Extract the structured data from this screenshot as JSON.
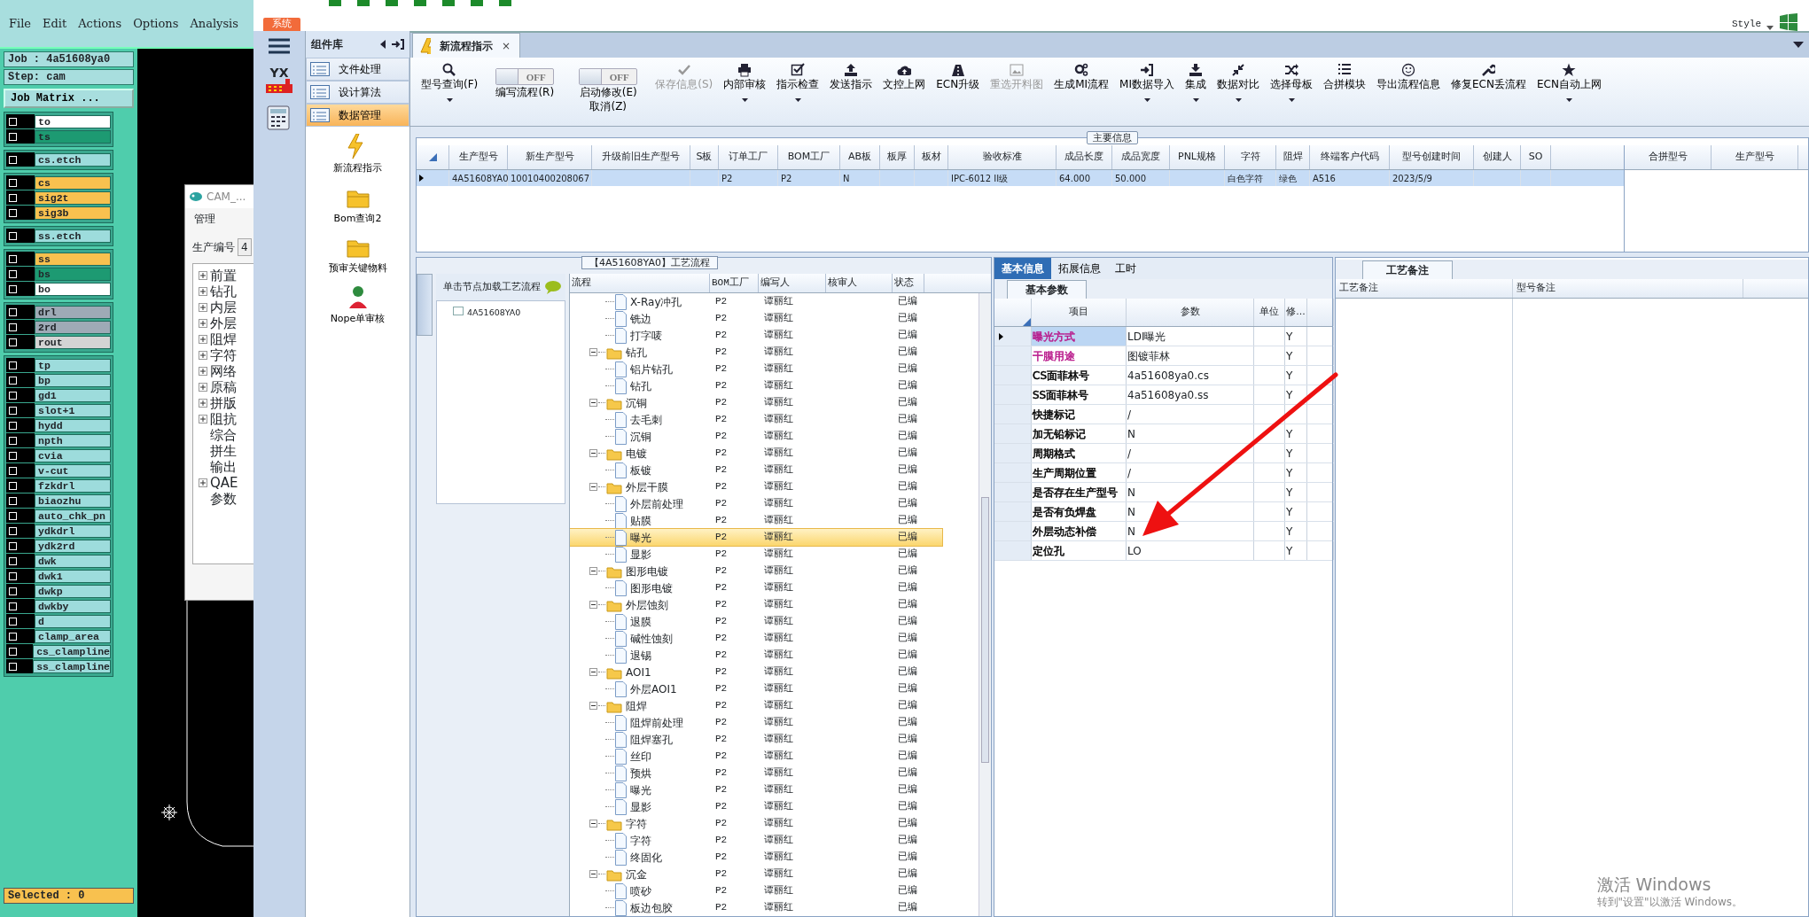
{
  "cam": {
    "menu": [
      "File",
      "Edit",
      "Actions",
      "Options",
      "Analysis"
    ],
    "job": "Job : 4a51608ya0",
    "step": "Step: cam",
    "matrix_button": "Job Matrix ...",
    "layer_groups": [
      {
        "layers": [
          {
            "name": "to",
            "color": "#ffffff",
            "checked": false
          },
          {
            "name": "ts",
            "color": "#1d9a72",
            "checked": false
          }
        ]
      },
      {
        "layers": [
          {
            "name": "cs.etch",
            "color": "#9ddcdc",
            "checked": false
          }
        ]
      },
      {
        "layers": [
          {
            "name": "cs",
            "color": "#f8c14f",
            "checked": false
          },
          {
            "name": "sig2t",
            "color": "#f8c14f",
            "checked": false
          },
          {
            "name": "sig3b",
            "color": "#f8c14f",
            "checked": false
          }
        ]
      },
      {
        "layers": [
          {
            "name": "ss.etch",
            "color": "#9ddcdc",
            "checked": false
          }
        ]
      },
      {
        "layers": [
          {
            "name": "ss",
            "color": "#f8c14f",
            "checked": false
          },
          {
            "name": "bs",
            "color": "#1d9a72",
            "checked": false
          },
          {
            "name": "bo",
            "color": "#ffffff",
            "checked": false
          }
        ]
      },
      {
        "layers": [
          {
            "name": "drl",
            "color": "#9eaab6",
            "checked": false
          },
          {
            "name": "2rd",
            "color": "#9eaab6",
            "checked": false
          },
          {
            "name": "rout",
            "color": "#d4d4d4",
            "checked": false
          }
        ]
      },
      {
        "layers": [
          {
            "name": "tp",
            "color": "#9ddcdc",
            "checked": false
          },
          {
            "name": "bp",
            "color": "#9ddcdc",
            "checked": false
          },
          {
            "name": "gd1",
            "color": "#9ddcdc",
            "checked": false
          },
          {
            "name": "slot+1",
            "color": "#9ddcdc",
            "checked": false
          },
          {
            "name": "hydd",
            "color": "#9ddcdc",
            "checked": false
          },
          {
            "name": "npth",
            "color": "#9ddcdc",
            "checked": false
          },
          {
            "name": "cvia",
            "color": "#9ddcdc",
            "checked": false
          },
          {
            "name": "v-cut",
            "color": "#9ddcdc",
            "checked": false
          },
          {
            "name": "fzkdrl",
            "color": "#9ddcdc",
            "checked": false
          },
          {
            "name": "biaozhu",
            "color": "#9ddcdc",
            "checked": false
          },
          {
            "name": "auto_chk_pn",
            "color": "#9ddcdc",
            "checked": false
          },
          {
            "name": "ydkdrl",
            "color": "#9ddcdc",
            "checked": false
          },
          {
            "name": "ydk2rd",
            "color": "#9ddcdc",
            "checked": false
          },
          {
            "name": "dwk",
            "color": "#9ddcdc",
            "checked": false
          },
          {
            "name": "dwk1",
            "color": "#9ddcdc",
            "checked": false
          },
          {
            "name": "dwkp",
            "color": "#9ddcdc",
            "checked": false
          },
          {
            "name": "dwkby",
            "color": "#9ddcdc",
            "checked": false
          },
          {
            "name": "d",
            "color": "#9ddcdc",
            "checked": false
          },
          {
            "name": "clamp_area",
            "color": "#9ddcdc",
            "checked": false
          },
          {
            "name": "cs_clampline",
            "color": "#9ddcdc",
            "checked": false
          },
          {
            "name": "ss_clampline",
            "color": "#9ddcdc",
            "checked": false
          }
        ]
      }
    ],
    "selected_count": "Selected : 0",
    "window": {
      "title": "CAM_...",
      "menu": "管理",
      "field_label": "生产编号",
      "field_value": "4",
      "tree": [
        {
          "label": "前置",
          "kind": "folder"
        },
        {
          "label": "钻孔",
          "kind": "folder"
        },
        {
          "label": "内层",
          "kind": "folder"
        },
        {
          "label": "外层",
          "kind": "folder"
        },
        {
          "label": "阻焊",
          "kind": "folder"
        },
        {
          "label": "字符",
          "kind": "folder"
        },
        {
          "label": "网络",
          "kind": "folder"
        },
        {
          "label": "原稿",
          "kind": "folder"
        },
        {
          "label": "拼版",
          "kind": "folder"
        },
        {
          "label": "阻抗",
          "kind": "folder"
        },
        {
          "label": "综合",
          "kind": "leaf"
        },
        {
          "label": "拼生",
          "kind": "leaf"
        },
        {
          "label": "输出",
          "kind": "leaf"
        },
        {
          "label": "QAE",
          "kind": "folder"
        },
        {
          "label": "参数",
          "kind": "leaf"
        }
      ]
    }
  },
  "app": {
    "system_tab": "系统",
    "style_menu": "Style",
    "rail_logo": "YX",
    "component_library": {
      "title": "组件库",
      "items": [
        {
          "label": "文件处理",
          "selected": false
        },
        {
          "label": "设计算法",
          "selected": false
        },
        {
          "label": "数据管理",
          "selected": true
        }
      ],
      "tools": [
        "新流程指示",
        "Bom查询2",
        "预审关键物料",
        "Nope单审核"
      ]
    },
    "document_tab": {
      "label": "新流程指示",
      "close": "×"
    },
    "toolbar": [
      {
        "kind": "button",
        "label": "型号查询(F)",
        "disabled": false,
        "dropdown": true
      },
      {
        "kind": "toggle",
        "toggle_text": "OFF",
        "on": false,
        "label": "编写流程(R)",
        "dropdown": false
      },
      {
        "kind": "toggle",
        "toggle_text": "OFF",
        "on": false,
        "label": "启动修改(E)",
        "label_2": "取消(Z)",
        "dropdown": false
      },
      {
        "kind": "button",
        "label": "保存信息(S)",
        "disabled": true,
        "dropdown": false
      },
      {
        "kind": "button",
        "label": "内部审核",
        "disabled": false,
        "dropdown": true
      },
      {
        "kind": "button",
        "label": "指示检查",
        "disabled": false,
        "dropdown": true
      },
      {
        "kind": "button",
        "label": "发送指示",
        "disabled": false,
        "dropdown": false
      },
      {
        "kind": "button",
        "label": "文控上网",
        "disabled": false,
        "dropdown": false
      },
      {
        "kind": "button",
        "label": "ECN升级",
        "disabled": false,
        "dropdown": false
      },
      {
        "kind": "button",
        "label": "重选开料图",
        "disabled": true,
        "dropdown": false
      },
      {
        "kind": "button",
        "label": "生成MI流程",
        "disabled": false,
        "dropdown": false
      },
      {
        "kind": "button",
        "label": "MI数据导入",
        "disabled": false,
        "dropdown": true
      },
      {
        "kind": "button",
        "label": "集成",
        "disabled": false,
        "dropdown": true
      },
      {
        "kind": "button",
        "label": "数据对比",
        "disabled": false,
        "dropdown": true
      },
      {
        "kind": "button",
        "label": "选择母板",
        "disabled": false,
        "dropdown": true
      },
      {
        "kind": "button",
        "label": "合拼模块",
        "disabled": false,
        "dropdown": false
      },
      {
        "kind": "button",
        "label": "导出流程信息",
        "disabled": false,
        "dropdown": false
      },
      {
        "kind": "button",
        "label": "修复ECN丢流程",
        "disabled": false,
        "dropdown": false
      },
      {
        "kind": "button",
        "label": "ECN自动上网",
        "disabled": false,
        "dropdown": true
      }
    ],
    "main_info": {
      "title": "主要信息",
      "columns": [
        "生产型号",
        "新生产型号",
        "升级前旧生产型号",
        "S板",
        "订单工厂",
        "BOM工厂",
        "AB板",
        "板厚",
        "板材",
        "验收标准",
        "成品长度",
        "成品宽度",
        "PNL规格",
        "字符",
        "阻焊",
        "终端客户代码",
        "型号创建时间",
        "创建人",
        "SO"
      ],
      "rows": [
        {
          "selected": true,
          "cells": [
            "4A51608YA0",
            "10010400208067",
            null,
            null,
            "P2",
            "P2",
            "N",
            null,
            null,
            "IPC-6012 II级",
            "64.000",
            "50.000",
            null,
            "白色字符",
            "绿色",
            "A516",
            "2023/5/9",
            null,
            null
          ]
        }
      ],
      "side_columns": [
        "合拼型号",
        "生产型号"
      ]
    },
    "process": {
      "title": "【4A51608YA0】工艺流程",
      "hint": "单击节点加载工艺流程",
      "node": "4A51608YA0",
      "columns": [
        "流程",
        "BOM工厂",
        "编写人",
        "核审人",
        "状态"
      ],
      "tree": [
        {
          "children": [
            {
              "label": "X-Ray冲孔",
              "bom": "P2",
              "writer": "谭丽红",
              "status": "已编",
              "selected": false
            },
            {
              "label": "铣边",
              "bom": "P2",
              "writer": "谭丽红",
              "status": "已编",
              "selected": false
            },
            {
              "label": "打字唛",
              "bom": "P2",
              "writer": "谭丽红",
              "status": "已编",
              "selected": false
            }
          ]
        },
        {
          "label": "钻孔",
          "bom": "P2",
          "writer": "谭丽红",
          "status": "已编",
          "selected": false,
          "expanded": true,
          "children": [
            {
              "label": "铝片钻孔",
              "bom": "P2",
              "writer": "谭丽红",
              "status": "已编",
              "selected": false
            },
            {
              "label": "钻孔",
              "bom": "P2",
              "writer": "谭丽红",
              "status": "已编",
              "selected": false
            }
          ]
        },
        {
          "label": "沉铜",
          "bom": "P2",
          "writer": "谭丽红",
          "status": "已编",
          "selected": false,
          "expanded": true,
          "children": [
            {
              "label": "去毛刺",
              "bom": "P2",
              "writer": "谭丽红",
              "status": "已编",
              "selected": false
            },
            {
              "label": "沉铜",
              "bom": "P2",
              "writer": "谭丽红",
              "status": "已编",
              "selected": false
            }
          ]
        },
        {
          "label": "电镀",
          "bom": "P2",
          "writer": "谭丽红",
          "status": "已编",
          "selected": false,
          "expanded": true,
          "children": [
            {
              "label": "板镀",
              "bom": "P2",
              "writer": "谭丽红",
              "status": "已编",
              "selected": false
            }
          ]
        },
        {
          "label": "外层干膜",
          "bom": "P2",
          "writer": "谭丽红",
          "status": "已编",
          "selected": false,
          "expanded": true,
          "children": [
            {
              "label": "外层前处理",
              "bom": "P2",
              "writer": "谭丽红",
              "status": "已编",
              "selected": false
            },
            {
              "label": "贴膜",
              "bom": "P2",
              "writer": "谭丽红",
              "status": "已编",
              "selected": false
            },
            {
              "label": "曝光",
              "bom": "P2",
              "writer": "谭丽红",
              "status": "已编",
              "selected": true
            },
            {
              "label": "显影",
              "bom": "P2",
              "writer": "谭丽红",
              "status": "已编",
              "selected": false
            }
          ]
        },
        {
          "label": "图形电镀",
          "bom": "P2",
          "writer": "谭丽红",
          "status": "已编",
          "selected": false,
          "expanded": true,
          "children": [
            {
              "label": "图形电镀",
              "bom": "P2",
              "writer": "谭丽红",
              "status": "已编",
              "selected": false
            }
          ]
        },
        {
          "label": "外层蚀刻",
          "bom": "P2",
          "writer": "谭丽红",
          "status": "已编",
          "selected": false,
          "expanded": true,
          "children": [
            {
              "label": "退膜",
              "bom": "P2",
              "writer": "谭丽红",
              "status": "已编",
              "selected": false
            },
            {
              "label": "碱性蚀刻",
              "bom": "P2",
              "writer": "谭丽红",
              "status": "已编",
              "selected": false
            },
            {
              "label": "退锡",
              "bom": "P2",
              "writer": "谭丽红",
              "status": "已编",
              "selected": false
            }
          ]
        },
        {
          "label": "AOI1",
          "bom": "P2",
          "writer": "谭丽红",
          "status": "已编",
          "selected": false,
          "expanded": true,
          "children": [
            {
              "label": "外层AOI1",
              "bom": "P2",
              "writer": "谭丽红",
              "status": "已编",
              "selected": false
            }
          ]
        },
        {
          "label": "阻焊",
          "bom": "P2",
          "writer": "谭丽红",
          "status": "已编",
          "selected": false,
          "expanded": true,
          "children": [
            {
              "label": "阻焊前处理",
              "bom": "P2",
              "writer": "谭丽红",
              "status": "已编",
              "selected": false
            },
            {
              "label": "阻焊塞孔",
              "bom": "P2",
              "writer": "谭丽红",
              "status": "已编",
              "selected": false
            },
            {
              "label": "丝印",
              "bom": "P2",
              "writer": "谭丽红",
              "status": "已编",
              "selected": false
            },
            {
              "label": "预烘",
              "bom": "P2",
              "writer": "谭丽红",
              "status": "已编",
              "selected": false
            },
            {
              "label": "曝光",
              "bom": "P2",
              "writer": "谭丽红",
              "status": "已编",
              "selected": false
            },
            {
              "label": "显影",
              "bom": "P2",
              "writer": "谭丽红",
              "status": "已编",
              "selected": false
            }
          ]
        },
        {
          "label": "字符",
          "bom": "P2",
          "writer": "谭丽红",
          "status": "已编",
          "selected": false,
          "expanded": true,
          "children": [
            {
              "label": "字符",
              "bom": "P2",
              "writer": "谭丽红",
              "status": "已编",
              "selected": false
            },
            {
              "label": "终固化",
              "bom": "P2",
              "writer": "谭丽红",
              "status": "已编",
              "selected": false
            }
          ]
        },
        {
          "label": "沉金",
          "bom": "P2",
          "writer": "谭丽红",
          "status": "已编",
          "selected": false,
          "expanded": true,
          "children": [
            {
              "label": "喷砂",
              "bom": "P2",
              "writer": "谭丽红",
              "status": "已编",
              "selected": false
            },
            {
              "label": "板边包胶",
              "bom": "P2",
              "writer": "谭丽红",
              "status": "已编",
              "selected": false
            }
          ]
        }
      ]
    },
    "details": {
      "tabs": [
        {
          "label": "基本信息",
          "selected": true
        },
        {
          "label": "拓展信息",
          "selected": false
        },
        {
          "label": "工时",
          "selected": false
        }
      ],
      "subtab": "基本参数",
      "columns": [
        "项目",
        "参数",
        "单位",
        "修..."
      ],
      "rows": [
        {
          "item": "曝光方式",
          "value": "LDI曝光",
          "flag": "Y",
          "color": "#b8178a",
          "selected": true
        },
        {
          "item": "干膜用途",
          "value": "图镀菲林",
          "flag": "Y",
          "color": "#b8178a",
          "selected": false
        },
        {
          "item": "CS面菲林号",
          "value": "4a51608ya0.cs",
          "flag": "Y",
          "color": "#000000",
          "selected": false
        },
        {
          "item": "SS面菲林号",
          "value": "4a51608ya0.ss",
          "flag": "Y",
          "color": "#000000",
          "selected": false
        },
        {
          "item": "快捷标记",
          "value": "/",
          "color": "#000000",
          "selected": false
        },
        {
          "item": "加无铅标记",
          "value": "N",
          "flag": "Y",
          "color": "#000000",
          "selected": false
        },
        {
          "item": "周期格式",
          "value": "/",
          "flag": "Y",
          "color": "#000000",
          "selected": false
        },
        {
          "item": "生产周期位置",
          "value": "/",
          "flag": "Y",
          "color": "#000000",
          "selected": false
        },
        {
          "item": "是否存在生产型号",
          "value": "N",
          "flag": "Y",
          "color": "#000000",
          "selected": false
        },
        {
          "item": "是否有负焊盘",
          "value": "N",
          "flag": "Y",
          "color": "#000000",
          "selected": false
        },
        {
          "item": "外层动态补偿",
          "value": "N",
          "flag": "Y",
          "color": "#000000",
          "selected": false
        },
        {
          "item": "定位孔",
          "value": "LO",
          "flag": "Y",
          "color": "#000000",
          "selected": false
        }
      ]
    },
    "remarks": {
      "tab": "工艺备注",
      "columns": [
        "工艺备注",
        "型号备注"
      ]
    },
    "activation": {
      "title": "激活 Windows",
      "text": "转到\"设置\"以激活 Windows。"
    }
  }
}
